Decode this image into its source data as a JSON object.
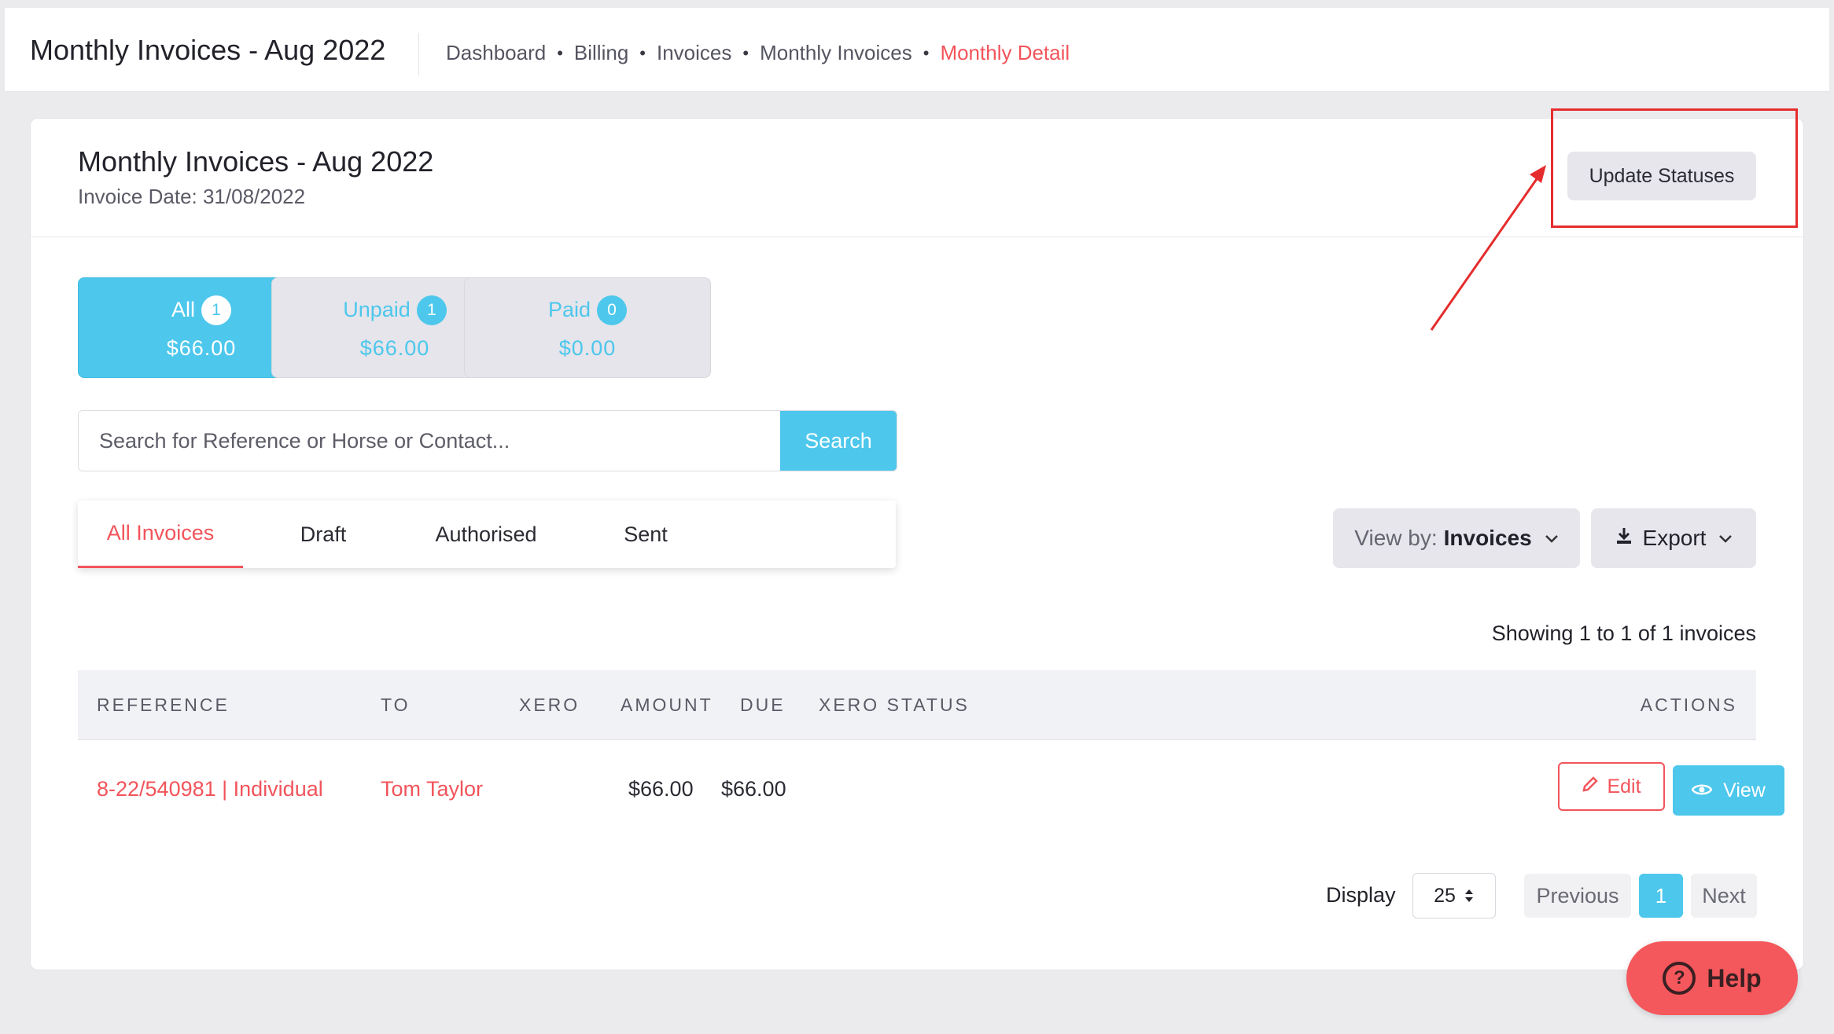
{
  "header": {
    "title": "Monthly Invoices - Aug 2022",
    "breadcrumbs": [
      "Dashboard",
      "Billing",
      "Invoices",
      "Monthly Invoices",
      "Monthly Detail"
    ]
  },
  "card": {
    "title": "Monthly Invoices - Aug 2022",
    "subtitle": "Invoice Date: 31/08/2022",
    "update_button": "Update Statuses"
  },
  "stats": [
    {
      "label": "All",
      "count": "1",
      "amount": "$66.00"
    },
    {
      "label": "Unpaid",
      "count": "1",
      "amount": "$66.00"
    },
    {
      "label": "Paid",
      "count": "0",
      "amount": "$0.00"
    }
  ],
  "search": {
    "placeholder": "Search for Reference or Horse or Contact...",
    "button": "Search"
  },
  "tabs": [
    "All Invoices",
    "Draft",
    "Authorised",
    "Sent"
  ],
  "toolbar": {
    "view_by_prefix": "View by:",
    "view_by_value": "Invoices",
    "export": "Export"
  },
  "showing": "Showing 1 to 1 of 1 invoices",
  "table": {
    "headers": [
      "REFERENCE",
      "TO",
      "XERO",
      "AMOUNT",
      "DUE",
      "XERO STATUS",
      "ACTIONS"
    ],
    "rows": [
      {
        "reference": "8-22/540981 | Individual",
        "to": "Tom Taylor",
        "xero": "",
        "amount": "$66.00",
        "due": "$66.00",
        "xero_status": "",
        "edit": "Edit",
        "view": "View"
      }
    ]
  },
  "pagination": {
    "display_label": "Display",
    "page_size": "25",
    "previous": "Previous",
    "page": "1",
    "next": "Next"
  },
  "help": "Help",
  "colors": {
    "accent": "#4dc7ec",
    "danger": "#f2545b",
    "highlight": "#e52d2d"
  },
  "icons": [
    "pencil-icon",
    "eye-icon",
    "download-icon",
    "chevron-down-icon",
    "question-circle-icon",
    "sort-arrows-icon"
  ]
}
